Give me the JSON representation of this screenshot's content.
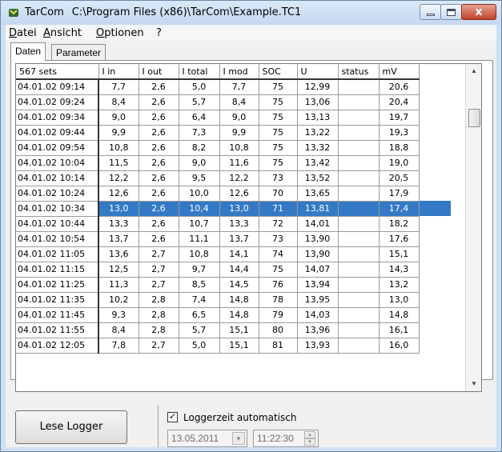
{
  "window": {
    "app_name": "TarCom",
    "file_path": "C:\\Program Files (x86)\\TarCom\\Example.TC1",
    "close_glyph": "x"
  },
  "menu": [
    "Datei",
    "Ansicht",
    "Optionen",
    "?"
  ],
  "tabs": [
    "Daten",
    "Parameter"
  ],
  "table": {
    "row_header_title": "567 sets",
    "columns": [
      "I in",
      "I out",
      "I total",
      "I mod",
      "SOC",
      "U",
      "status",
      "mV"
    ],
    "selected_row_index": 8,
    "rows": [
      {
        "time": "04.01.02 09:14",
        "cells": [
          "7,7",
          "2,6",
          "5,0",
          "7,7",
          "75",
          "12,99",
          "",
          "20,6"
        ]
      },
      {
        "time": "04.01.02 09:24",
        "cells": [
          "8,4",
          "2,6",
          "5,7",
          "8,4",
          "75",
          "13,06",
          "",
          "20,4"
        ]
      },
      {
        "time": "04.01.02 09:34",
        "cells": [
          "9,0",
          "2,6",
          "6,4",
          "9,0",
          "75",
          "13,13",
          "",
          "19,7"
        ]
      },
      {
        "time": "04.01.02 09:44",
        "cells": [
          "9,9",
          "2,6",
          "7,3",
          "9,9",
          "75",
          "13,22",
          "",
          "19,3"
        ]
      },
      {
        "time": "04.01.02 09:54",
        "cells": [
          "10,8",
          "2,6",
          "8,2",
          "10,8",
          "75",
          "13,32",
          "",
          "18,8"
        ]
      },
      {
        "time": "04.01.02 10:04",
        "cells": [
          "11,5",
          "2,6",
          "9,0",
          "11,6",
          "75",
          "13,42",
          "",
          "19,0"
        ]
      },
      {
        "time": "04.01.02 10:14",
        "cells": [
          "12,2",
          "2,6",
          "9,5",
          "12,2",
          "73",
          "13,52",
          "",
          "20,5"
        ]
      },
      {
        "time": "04.01.02 10:24",
        "cells": [
          "12,6",
          "2,6",
          "10,0",
          "12,6",
          "70",
          "13,65",
          "",
          "17,9"
        ]
      },
      {
        "time": "04.01.02 10:34",
        "cells": [
          "13,0",
          "2,6",
          "10,4",
          "13,0",
          "71",
          "13,81",
          "",
          "17,4"
        ]
      },
      {
        "time": "04.01.02 10:44",
        "cells": [
          "13,3",
          "2,6",
          "10,7",
          "13,3",
          "72",
          "14,01",
          "",
          "18,2"
        ]
      },
      {
        "time": "04.01.02 10:54",
        "cells": [
          "13,7",
          "2,6",
          "11,1",
          "13,7",
          "73",
          "13,90",
          "",
          "17,6"
        ]
      },
      {
        "time": "04.01.02 11:05",
        "cells": [
          "13,6",
          "2,7",
          "10,8",
          "14,1",
          "74",
          "13,90",
          "",
          "15,1"
        ]
      },
      {
        "time": "04.01.02 11:15",
        "cells": [
          "12,5",
          "2,7",
          "9,7",
          "14,4",
          "75",
          "14,07",
          "",
          "14,3"
        ]
      },
      {
        "time": "04.01.02 11:25",
        "cells": [
          "11,3",
          "2,7",
          "8,5",
          "14,5",
          "76",
          "13,94",
          "",
          "13,2"
        ]
      },
      {
        "time": "04.01.02 11:35",
        "cells": [
          "10,2",
          "2,8",
          "7,4",
          "14,8",
          "78",
          "13,95",
          "",
          "13,0"
        ]
      },
      {
        "time": "04.01.02 11:45",
        "cells": [
          "9,3",
          "2,8",
          "6,5",
          "14,8",
          "79",
          "14,03",
          "",
          "14,8"
        ]
      },
      {
        "time": "04.01.02 11:55",
        "cells": [
          "8,4",
          "2,8",
          "5,7",
          "15,1",
          "80",
          "13,96",
          "",
          "16,1"
        ]
      },
      {
        "time": "04.01.02 12:05",
        "cells": [
          "7,8",
          "2,7",
          "5,0",
          "15,1",
          "81",
          "13,93",
          "",
          "16,0"
        ]
      }
    ]
  },
  "bottom": {
    "read_button": "Lese Logger",
    "checkbox_checked": true,
    "checkbox_mark": "✓",
    "checkbox_label": "Loggerzeit automatisch",
    "date_value": "13.05.2011",
    "time_value": "11:22:30"
  },
  "icons": {
    "app": "tarcom-app-icon",
    "scroll_up": "scroll-up-arrow-icon",
    "scroll_down": "scroll-down-arrow-icon",
    "dropdown": "chevron-down-icon",
    "spin": "spinner-icon"
  },
  "colors": {
    "selection": "#3379c6",
    "titlebar": "#c4d8ef",
    "close_button": "#c1432a"
  }
}
